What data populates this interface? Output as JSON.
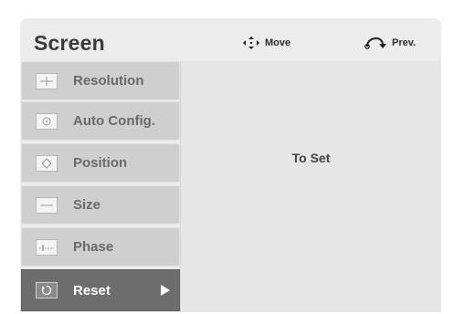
{
  "header": {
    "title": "Screen",
    "move_hint": "Move",
    "prev_hint": "Prev.",
    "move_icon": "four-way-arrows-icon",
    "prev_icon": "return-arrow-icon"
  },
  "menu": {
    "items": [
      {
        "label": "Resolution",
        "icon": "resolution-icon"
      },
      {
        "label": "Auto Config.",
        "icon": "auto-config-icon"
      },
      {
        "label": "Position",
        "icon": "position-icon"
      },
      {
        "label": "Size",
        "icon": "size-icon"
      },
      {
        "label": "Phase",
        "icon": "phase-icon"
      },
      {
        "label": "Reset",
        "icon": "reset-icon",
        "selected": true
      }
    ]
  },
  "content": {
    "text": "To Set"
  },
  "colors": {
    "panel_bg": "#ececec",
    "item_bg": "#cfcfcf",
    "selected_bg": "#6d6d6d",
    "content_bg": "#e6e6e6"
  }
}
